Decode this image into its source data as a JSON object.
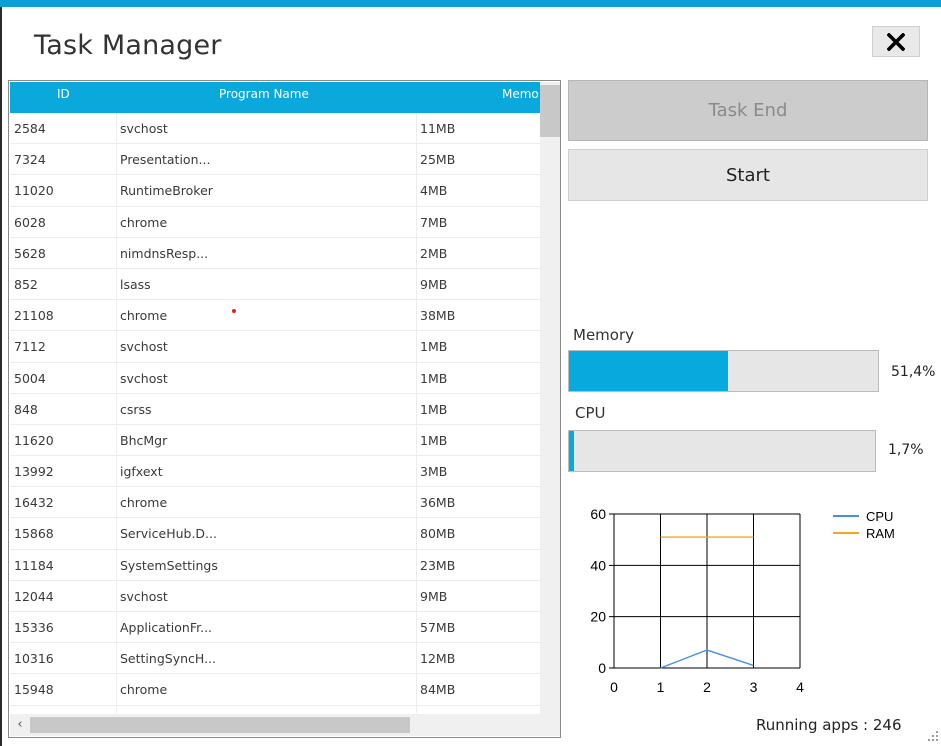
{
  "window": {
    "title": "Task Manager",
    "close_label": "close"
  },
  "grid": {
    "columns": [
      "ID",
      "Program Name",
      "Memo"
    ],
    "rows": [
      {
        "id": "2584",
        "name": "svchost",
        "mem": "11MB"
      },
      {
        "id": "7324",
        "name": "Presentation...",
        "mem": "25MB"
      },
      {
        "id": "11020",
        "name": "RuntimeBroker",
        "mem": "4MB"
      },
      {
        "id": "6028",
        "name": "chrome",
        "mem": "7MB"
      },
      {
        "id": "5628",
        "name": "nimdnsResp...",
        "mem": "2MB"
      },
      {
        "id": "852",
        "name": "lsass",
        "mem": "9MB"
      },
      {
        "id": "21108",
        "name": "chrome",
        "mem": "38MB"
      },
      {
        "id": "7112",
        "name": "svchost",
        "mem": "1MB"
      },
      {
        "id": "5004",
        "name": "svchost",
        "mem": "1MB"
      },
      {
        "id": "848",
        "name": "csrss",
        "mem": "1MB"
      },
      {
        "id": "11620",
        "name": "BhcMgr",
        "mem": "1MB"
      },
      {
        "id": "13992",
        "name": "igfxext",
        "mem": "3MB"
      },
      {
        "id": "16432",
        "name": "chrome",
        "mem": "36MB"
      },
      {
        "id": "15868",
        "name": "ServiceHub.D...",
        "mem": "80MB"
      },
      {
        "id": "11184",
        "name": "SystemSettings",
        "mem": "23MB"
      },
      {
        "id": "12044",
        "name": "svchost",
        "mem": "9MB"
      },
      {
        "id": "15336",
        "name": "ApplicationFr...",
        "mem": "57MB"
      },
      {
        "id": "10316",
        "name": "SettingSyncH...",
        "mem": "12MB"
      },
      {
        "id": "15948",
        "name": "chrome",
        "mem": "84MB"
      }
    ]
  },
  "actions": {
    "task_end_label": "Task End",
    "start_label": "Start"
  },
  "memory": {
    "label": "Memory",
    "percent_text": "51,4%",
    "fraction": 0.514
  },
  "cpu": {
    "label": "CPU",
    "percent_text": "1,7%",
    "fraction": 0.017
  },
  "chart_data": {
    "type": "line",
    "x_ticks": [
      "0",
      "1",
      "2",
      "3",
      "4"
    ],
    "y_ticks": [
      "0",
      "20",
      "40",
      "60"
    ],
    "xlim": [
      0,
      4
    ],
    "ylim": [
      0,
      60
    ],
    "grid": true,
    "legend_position": "top-right",
    "series": [
      {
        "name": "CPU",
        "color": "#4a90e2",
        "x": [
          1,
          2,
          3
        ],
        "y": [
          0,
          7,
          1
        ]
      },
      {
        "name": "RAM",
        "color": "#f5a623",
        "x": [
          1,
          2,
          3
        ],
        "y": [
          51,
          51,
          51
        ]
      }
    ]
  },
  "status": {
    "running_apps": "Running apps : 246"
  },
  "colors": {
    "accent": "#0ba8dc"
  }
}
